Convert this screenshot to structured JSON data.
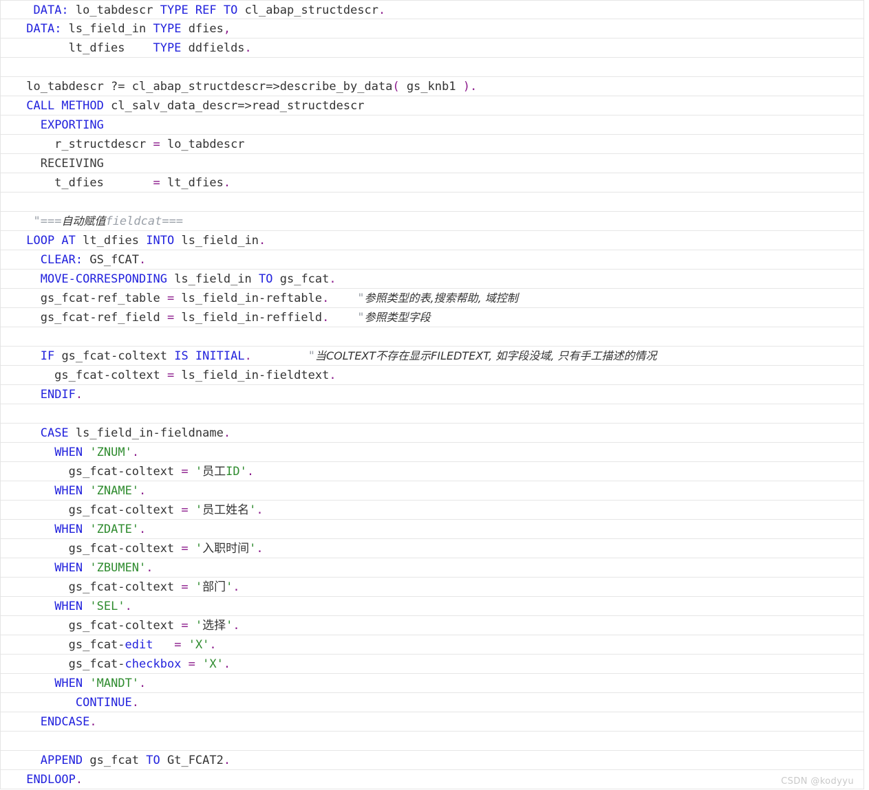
{
  "editor": {
    "language": "ABAP",
    "line_height_px": 28,
    "font_size_px": 17,
    "colors": {
      "background": "#ffffff",
      "text": "#333333",
      "keyword": "#2222dd",
      "operator": "#8b1a8b",
      "string": "#2e8b2e",
      "comment": "#9aa0a8",
      "line_rule": "#e6e6e6",
      "border": "#e4e4e4",
      "watermark": "#c9c9c9"
    }
  },
  "watermark": {
    "text": "CSDN @kodyyu"
  },
  "code": {
    "lines": [
      {
        "n": 1,
        "tokens": [
          {
            "t": "  ",
            "c": "pl"
          },
          {
            "t": "DATA:",
            "c": "kw"
          },
          {
            "t": " lo_tabdescr ",
            "c": "pl"
          },
          {
            "t": "TYPE REF TO",
            "c": "kw"
          },
          {
            "t": " cl_abap_structdescr",
            "c": "pl"
          },
          {
            "t": ".",
            "c": "op"
          }
        ]
      },
      {
        "n": 2,
        "tokens": [
          {
            "t": " ",
            "c": "pl"
          },
          {
            "t": "DATA:",
            "c": "kw"
          },
          {
            "t": " ls_field_in ",
            "c": "pl"
          },
          {
            "t": "TYPE",
            "c": "kw"
          },
          {
            "t": " dfies",
            "c": "pl"
          },
          {
            "t": ",",
            "c": "op"
          }
        ]
      },
      {
        "n": 3,
        "tokens": [
          {
            "t": "       lt_dfies    ",
            "c": "pl"
          },
          {
            "t": "TYPE",
            "c": "kw"
          },
          {
            "t": " ddfields",
            "c": "pl"
          },
          {
            "t": ".",
            "c": "op"
          }
        ]
      },
      {
        "n": 4,
        "tokens": []
      },
      {
        "n": 5,
        "tokens": [
          {
            "t": " lo_tabdescr ?= cl_abap_structdescr=>describe_by_data",
            "c": "pl"
          },
          {
            "t": "(",
            "c": "op"
          },
          {
            "t": " gs_knb1 ",
            "c": "pl"
          },
          {
            "t": ")",
            "c": "op"
          },
          {
            "t": ".",
            "c": "op"
          }
        ]
      },
      {
        "n": 6,
        "tokens": [
          {
            "t": " ",
            "c": "pl"
          },
          {
            "t": "CALL METHOD",
            "c": "kw"
          },
          {
            "t": " cl_salv_data_descr=>read_structdescr",
            "c": "pl"
          }
        ]
      },
      {
        "n": 7,
        "tokens": [
          {
            "t": "   ",
            "c": "pl"
          },
          {
            "t": "EXPORTING",
            "c": "kw"
          }
        ]
      },
      {
        "n": 8,
        "tokens": [
          {
            "t": "     r_structdescr ",
            "c": "pl"
          },
          {
            "t": "=",
            "c": "op"
          },
          {
            "t": " lo_tabdescr",
            "c": "pl"
          }
        ]
      },
      {
        "n": 9,
        "tokens": [
          {
            "t": "   ",
            "c": "pl"
          },
          {
            "t": "RECEIVING",
            "c": "dk"
          }
        ]
      },
      {
        "n": 10,
        "tokens": [
          {
            "t": "     t_dfies       ",
            "c": "pl"
          },
          {
            "t": "=",
            "c": "op"
          },
          {
            "t": " lt_dfies",
            "c": "pl"
          },
          {
            "t": ".",
            "c": "op"
          }
        ]
      },
      {
        "n": 11,
        "tokens": []
      },
      {
        "n": 12,
        "tokens": [
          {
            "t": "  ",
            "c": "pl"
          },
          {
            "t": "\"===",
            "c": "cmt"
          },
          {
            "t": "自动赋值",
            "c": "cmt-cjk"
          },
          {
            "t": "fieldcat===",
            "c": "cmt"
          }
        ]
      },
      {
        "n": 13,
        "tokens": [
          {
            "t": " ",
            "c": "pl"
          },
          {
            "t": "LOOP AT",
            "c": "kw"
          },
          {
            "t": " lt_dfies ",
            "c": "pl"
          },
          {
            "t": "INTO",
            "c": "kw"
          },
          {
            "t": " ls_field_in",
            "c": "pl"
          },
          {
            "t": ".",
            "c": "op"
          }
        ]
      },
      {
        "n": 14,
        "tokens": [
          {
            "t": "   ",
            "c": "pl"
          },
          {
            "t": "CLEAR:",
            "c": "kw"
          },
          {
            "t": " GS_fCAT",
            "c": "pl"
          },
          {
            "t": ".",
            "c": "op"
          }
        ]
      },
      {
        "n": 15,
        "tokens": [
          {
            "t": "   ",
            "c": "pl"
          },
          {
            "t": "MOVE-CORRESPONDING",
            "c": "kw"
          },
          {
            "t": " ls_field_in ",
            "c": "pl"
          },
          {
            "t": "TO",
            "c": "kw"
          },
          {
            "t": " gs_fcat",
            "c": "pl"
          },
          {
            "t": ".",
            "c": "op"
          }
        ]
      },
      {
        "n": 16,
        "tokens": [
          {
            "t": "   gs_fcat-ref_table ",
            "c": "pl"
          },
          {
            "t": "=",
            "c": "op"
          },
          {
            "t": " ls_field_in-reftable",
            "c": "pl"
          },
          {
            "t": ".",
            "c": "op"
          },
          {
            "t": "    ",
            "c": "pl"
          },
          {
            "t": "\"",
            "c": "cmt"
          },
          {
            "t": "参照类型的表,搜索帮助, 域控制",
            "c": "cmt-cjk"
          }
        ]
      },
      {
        "n": 17,
        "tokens": [
          {
            "t": "   gs_fcat-ref_field ",
            "c": "pl"
          },
          {
            "t": "=",
            "c": "op"
          },
          {
            "t": " ls_field_in-reffield",
            "c": "pl"
          },
          {
            "t": ".",
            "c": "op"
          },
          {
            "t": "    ",
            "c": "pl"
          },
          {
            "t": "\"",
            "c": "cmt"
          },
          {
            "t": "参照类型字段",
            "c": "cmt-cjk"
          }
        ]
      },
      {
        "n": 18,
        "tokens": []
      },
      {
        "n": 19,
        "tokens": [
          {
            "t": "   ",
            "c": "pl"
          },
          {
            "t": "IF",
            "c": "kw"
          },
          {
            "t": " gs_fcat-coltext ",
            "c": "pl"
          },
          {
            "t": "IS INITIAL",
            "c": "kw"
          },
          {
            "t": ".",
            "c": "op"
          },
          {
            "t": "        ",
            "c": "pl"
          },
          {
            "t": "\"",
            "c": "cmt"
          },
          {
            "t": "当COLTEXT不存在显示FILEDTEXT, 如字段没域, 只有手工描述的情况",
            "c": "cmt-cjk"
          }
        ]
      },
      {
        "n": 20,
        "tokens": [
          {
            "t": "     gs_fcat-coltext ",
            "c": "pl"
          },
          {
            "t": "=",
            "c": "op"
          },
          {
            "t": " ls_field_in-fieldtext",
            "c": "pl"
          },
          {
            "t": ".",
            "c": "op"
          }
        ]
      },
      {
        "n": 21,
        "tokens": [
          {
            "t": "   ",
            "c": "pl"
          },
          {
            "t": "ENDIF",
            "c": "kw"
          },
          {
            "t": ".",
            "c": "op"
          }
        ]
      },
      {
        "n": 22,
        "tokens": []
      },
      {
        "n": 23,
        "tokens": [
          {
            "t": "   ",
            "c": "pl"
          },
          {
            "t": "CASE",
            "c": "kw"
          },
          {
            "t": " ls_field_in-fieldname",
            "c": "pl"
          },
          {
            "t": ".",
            "c": "op"
          }
        ]
      },
      {
        "n": 24,
        "tokens": [
          {
            "t": "     ",
            "c": "pl"
          },
          {
            "t": "WHEN",
            "c": "kw"
          },
          {
            "t": " ",
            "c": "pl"
          },
          {
            "t": "'ZNUM'",
            "c": "str"
          },
          {
            "t": ".",
            "c": "op"
          }
        ]
      },
      {
        "n": 25,
        "tokens": [
          {
            "t": "       gs_fcat-coltext ",
            "c": "pl"
          },
          {
            "t": "=",
            "c": "op"
          },
          {
            "t": " ",
            "c": "pl"
          },
          {
            "t": "'",
            "c": "str"
          },
          {
            "t": "员工",
            "c": "str-cjk"
          },
          {
            "t": "ID'",
            "c": "str"
          },
          {
            "t": ".",
            "c": "op"
          }
        ]
      },
      {
        "n": 26,
        "tokens": [
          {
            "t": "     ",
            "c": "pl"
          },
          {
            "t": "WHEN",
            "c": "kw"
          },
          {
            "t": " ",
            "c": "pl"
          },
          {
            "t": "'ZNAME'",
            "c": "str"
          },
          {
            "t": ".",
            "c": "op"
          }
        ]
      },
      {
        "n": 27,
        "tokens": [
          {
            "t": "       gs_fcat-coltext ",
            "c": "pl"
          },
          {
            "t": "=",
            "c": "op"
          },
          {
            "t": " ",
            "c": "pl"
          },
          {
            "t": "'",
            "c": "str"
          },
          {
            "t": "员工姓名",
            "c": "str-cjk"
          },
          {
            "t": "'",
            "c": "str"
          },
          {
            "t": ".",
            "c": "op"
          }
        ]
      },
      {
        "n": 28,
        "tokens": [
          {
            "t": "     ",
            "c": "pl"
          },
          {
            "t": "WHEN",
            "c": "kw"
          },
          {
            "t": " ",
            "c": "pl"
          },
          {
            "t": "'ZDATE'",
            "c": "str"
          },
          {
            "t": ".",
            "c": "op"
          }
        ]
      },
      {
        "n": 29,
        "tokens": [
          {
            "t": "       gs_fcat-coltext ",
            "c": "pl"
          },
          {
            "t": "=",
            "c": "op"
          },
          {
            "t": " ",
            "c": "pl"
          },
          {
            "t": "'",
            "c": "str"
          },
          {
            "t": "入职时间",
            "c": "str-cjk"
          },
          {
            "t": "'",
            "c": "str"
          },
          {
            "t": ".",
            "c": "op"
          }
        ]
      },
      {
        "n": 30,
        "tokens": [
          {
            "t": "     ",
            "c": "pl"
          },
          {
            "t": "WHEN",
            "c": "kw"
          },
          {
            "t": " ",
            "c": "pl"
          },
          {
            "t": "'ZBUMEN'",
            "c": "str"
          },
          {
            "t": ".",
            "c": "op"
          }
        ]
      },
      {
        "n": 31,
        "tokens": [
          {
            "t": "       gs_fcat-coltext ",
            "c": "pl"
          },
          {
            "t": "=",
            "c": "op"
          },
          {
            "t": " ",
            "c": "pl"
          },
          {
            "t": "'",
            "c": "str"
          },
          {
            "t": "部门",
            "c": "str-cjk"
          },
          {
            "t": "'",
            "c": "str"
          },
          {
            "t": ".",
            "c": "op"
          }
        ]
      },
      {
        "n": 32,
        "tokens": [
          {
            "t": "     ",
            "c": "pl"
          },
          {
            "t": "WHEN",
            "c": "kw"
          },
          {
            "t": " ",
            "c": "pl"
          },
          {
            "t": "'SEL'",
            "c": "str"
          },
          {
            "t": ".",
            "c": "op"
          }
        ]
      },
      {
        "n": 33,
        "tokens": [
          {
            "t": "       gs_fcat-coltext ",
            "c": "pl"
          },
          {
            "t": "=",
            "c": "op"
          },
          {
            "t": " ",
            "c": "pl"
          },
          {
            "t": "'",
            "c": "str"
          },
          {
            "t": "选择",
            "c": "str-cjk"
          },
          {
            "t": "'",
            "c": "str"
          },
          {
            "t": ".",
            "c": "op"
          }
        ]
      },
      {
        "n": 34,
        "tokens": [
          {
            "t": "       gs_fcat-",
            "c": "pl"
          },
          {
            "t": "edit",
            "c": "kw"
          },
          {
            "t": "   ",
            "c": "pl"
          },
          {
            "t": "=",
            "c": "op"
          },
          {
            "t": " ",
            "c": "pl"
          },
          {
            "t": "'X'",
            "c": "str"
          },
          {
            "t": ".",
            "c": "op"
          }
        ]
      },
      {
        "n": 35,
        "tokens": [
          {
            "t": "       gs_fcat-",
            "c": "pl"
          },
          {
            "t": "checkbox",
            "c": "kw"
          },
          {
            "t": " ",
            "c": "pl"
          },
          {
            "t": "=",
            "c": "op"
          },
          {
            "t": " ",
            "c": "pl"
          },
          {
            "t": "'X'",
            "c": "str"
          },
          {
            "t": ".",
            "c": "op"
          }
        ]
      },
      {
        "n": 36,
        "tokens": [
          {
            "t": "     ",
            "c": "pl"
          },
          {
            "t": "WHEN",
            "c": "kw"
          },
          {
            "t": " ",
            "c": "pl"
          },
          {
            "t": "'MANDT'",
            "c": "str"
          },
          {
            "t": ".",
            "c": "op"
          }
        ]
      },
      {
        "n": 37,
        "tokens": [
          {
            "t": "        ",
            "c": "pl"
          },
          {
            "t": "CONTINUE",
            "c": "kw"
          },
          {
            "t": ".",
            "c": "op"
          }
        ]
      },
      {
        "n": 38,
        "tokens": [
          {
            "t": "   ",
            "c": "pl"
          },
          {
            "t": "ENDCASE",
            "c": "kw"
          },
          {
            "t": ".",
            "c": "op"
          }
        ]
      },
      {
        "n": 39,
        "tokens": []
      },
      {
        "n": 40,
        "tokens": [
          {
            "t": "   ",
            "c": "pl"
          },
          {
            "t": "APPEND",
            "c": "kw"
          },
          {
            "t": " gs_fcat ",
            "c": "pl"
          },
          {
            "t": "TO",
            "c": "kw"
          },
          {
            "t": " Gt_FCAT2",
            "c": "pl"
          },
          {
            "t": ".",
            "c": "op"
          }
        ]
      },
      {
        "n": 41,
        "tokens": [
          {
            "t": " ",
            "c": "pl"
          },
          {
            "t": "ENDLOOP",
            "c": "kw"
          },
          {
            "t": ".",
            "c": "op"
          }
        ]
      }
    ]
  }
}
